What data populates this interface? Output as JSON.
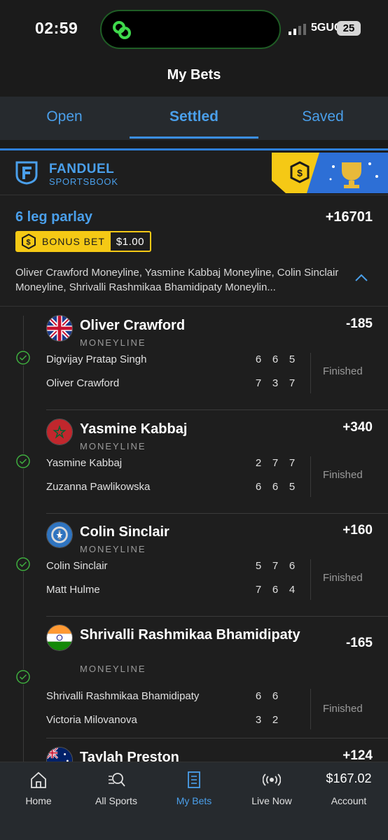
{
  "status_bar": {
    "time": "02:59",
    "network": "5GUC",
    "battery": "25"
  },
  "page_title": "My Bets",
  "tabs": [
    {
      "label": "Open"
    },
    {
      "label": "Settled"
    },
    {
      "label": "Saved"
    }
  ],
  "brand": {
    "name": "FANDUEL",
    "sub": "SPORTSBOOK"
  },
  "bet": {
    "title": "6 leg parlay",
    "odds": "+16701",
    "bonus_label": "BONUS BET",
    "bonus_amount": "$1.00",
    "summary": "Oliver Crawford Moneyline, Yasmine Kabbaj Moneyline, Colin Sinclair Moneyline, Shrivalli Rashmikaa Bhamidipaty Moneylin..."
  },
  "legs": [
    {
      "name": "Oliver Crawford",
      "market": "MONEYLINE",
      "odds": "-185",
      "status": "Finished",
      "flag": "uk-flag-icon",
      "players": [
        {
          "name": "Digvijay Pratap Singh",
          "sets": [
            "6",
            "6",
            "5"
          ]
        },
        {
          "name": "Oliver Crawford",
          "sets": [
            "7",
            "3",
            "7"
          ]
        }
      ]
    },
    {
      "name": "Yasmine Kabbaj",
      "market": "MONEYLINE",
      "odds": "+340",
      "status": "Finished",
      "flag": "morocco-flag-icon",
      "players": [
        {
          "name": "Yasmine Kabbaj",
          "sets": [
            "2",
            "7",
            "7"
          ]
        },
        {
          "name": "Zuzanna Pawlikowska",
          "sets": [
            "6",
            "6",
            "5"
          ]
        }
      ]
    },
    {
      "name": "Colin Sinclair",
      "market": "MONEYLINE",
      "odds": "+160",
      "status": "Finished",
      "flag": "northern-mariana-flag-icon",
      "players": [
        {
          "name": "Colin Sinclair",
          "sets": [
            "5",
            "7",
            "6"
          ]
        },
        {
          "name": "Matt Hulme",
          "sets": [
            "7",
            "6",
            "4"
          ]
        }
      ]
    },
    {
      "name": "Shrivalli Rashmikaa Bhamidipaty",
      "market": "MONEYLINE",
      "odds": "-165",
      "status": "Finished",
      "flag": "india-flag-icon",
      "players": [
        {
          "name": "Shrivalli Rashmikaa Bhamidipaty",
          "sets": [
            "6",
            "6"
          ]
        },
        {
          "name": "Victoria Milovanova",
          "sets": [
            "3",
            "2"
          ]
        }
      ]
    },
    {
      "name": "Taylah Preston",
      "odds": "+124",
      "flag": "australia-flag-icon"
    }
  ],
  "nav": [
    {
      "label": "Home",
      "icon": "home-icon"
    },
    {
      "label": "All Sports",
      "icon": "search-sports-icon"
    },
    {
      "label": "My Bets",
      "icon": "bets-slip-icon"
    },
    {
      "label": "Live Now",
      "icon": "live-broadcast-icon"
    },
    {
      "label": "Account",
      "balance": "$167.02"
    }
  ],
  "colors": {
    "accent": "#4a9fea",
    "bonus": "#f5c915",
    "success": "#3fae3f",
    "background": "#1b1b1b"
  }
}
